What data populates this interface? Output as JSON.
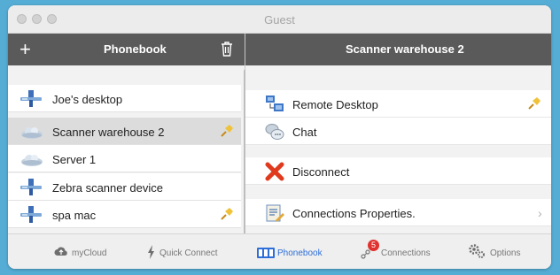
{
  "window": {
    "title": "Guest"
  },
  "left_header": {
    "title": "Phonebook"
  },
  "right_header": {
    "title": "Scanner warehouse 2"
  },
  "phonebook": {
    "items": [
      {
        "label": "Joe's desktop",
        "icon": "computer-icon",
        "pinned": false,
        "selected": false
      },
      {
        "label": "Scanner warehouse 2",
        "icon": "cloud-icon",
        "pinned": true,
        "selected": true
      },
      {
        "label": "Server 1",
        "icon": "cloud-icon",
        "pinned": false,
        "selected": false
      },
      {
        "label": "Zebra scanner device",
        "icon": "computer-icon",
        "pinned": false,
        "selected": false
      },
      {
        "label": "spa mac",
        "icon": "computer-icon",
        "pinned": true,
        "selected": false
      }
    ]
  },
  "actions": {
    "remote_desktop": "Remote Desktop",
    "chat": "Chat",
    "disconnect": "Disconnect",
    "properties": "Connections Properties."
  },
  "tabs": {
    "mycloud": "myCloud",
    "quick_connect": "Quick Connect",
    "phonebook": "Phonebook",
    "connections": "Connections",
    "connections_badge": "5",
    "options": "Options",
    "active": "phonebook"
  },
  "colors": {
    "accent": "#2d6ed8",
    "header": "#5a5a5a",
    "badge": "#e0322e",
    "background": "#55acd4"
  }
}
